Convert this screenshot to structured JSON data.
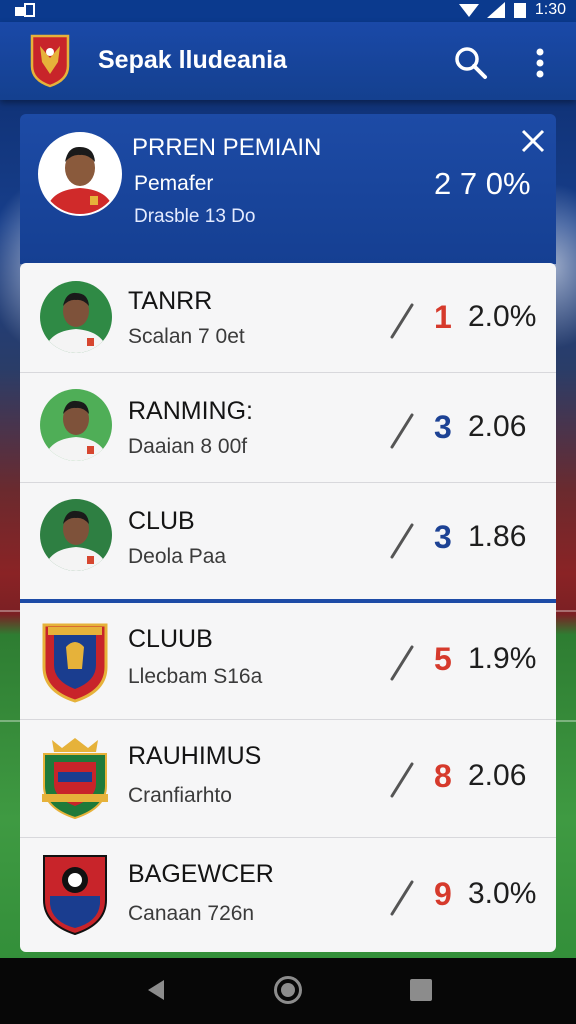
{
  "status_bar": {
    "time": "1:30"
  },
  "app_bar": {
    "title": "Sepak lludeania"
  },
  "featured": {
    "title": "PRREN PEMIAIN",
    "subtitle": "Pemafer",
    "meta": "Drasble 13 Do",
    "stat": "2 7 0%"
  },
  "players": [
    {
      "title": "TANRR",
      "subtitle": "Scalan 7 0et",
      "rank": "1",
      "value": "2.0%",
      "rank_color": "#d63a2c",
      "jersey": "#f4f4f4",
      "bg": "#2f8a45"
    },
    {
      "title": "RANMING:",
      "subtitle": "Daaian 8 00f",
      "rank": "3",
      "value": "2.06",
      "rank_color": "#1d4294",
      "jersey": "#f4f4f4",
      "bg": "#4fae57"
    },
    {
      "title": "CLUB",
      "subtitle": "Deola Paa",
      "rank": "3",
      "value": "1.86",
      "rank_color": "#1d4294",
      "jersey": "#f4f4f4",
      "bg": "#2e7f42"
    }
  ],
  "clubs": [
    {
      "title": "CLUUB",
      "subtitle": "Llecbam S16a",
      "rank": "5",
      "value": "1.9%",
      "rank_color": "#d63a2c",
      "crest_main": "#c8242a",
      "crest_inner": "#1a3d8f"
    },
    {
      "title": "RAUHIMUS",
      "subtitle": "Cranfiarhto",
      "rank": "8",
      "value": "2.06",
      "rank_color": "#d63a2c",
      "crest_main": "#1e7a3a",
      "crest_inner": "#c8242a"
    },
    {
      "title": "BAGEWCER",
      "subtitle": "Canaan 726n",
      "rank": "9",
      "value": "3.0%",
      "rank_color": "#d63a2c",
      "crest_main": "#c8242a",
      "crest_inner": "#1a3d8f"
    }
  ],
  "icons": {
    "search": "search-icon",
    "menu": "more-vert-icon",
    "close": "close-icon",
    "back": "back-icon",
    "home": "home-icon",
    "recent": "recent-apps-icon"
  }
}
